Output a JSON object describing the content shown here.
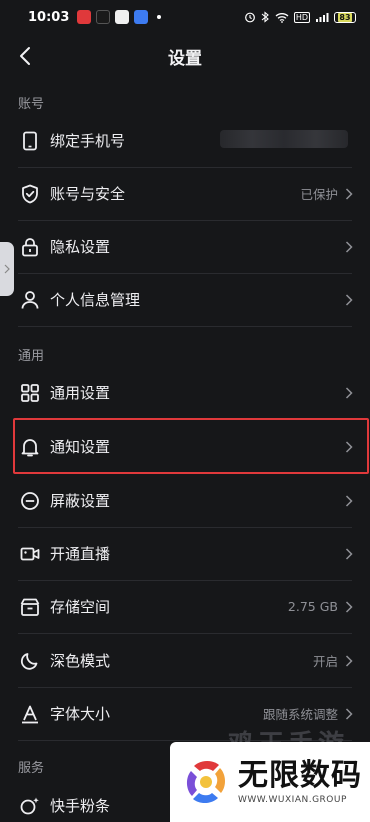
{
  "status_bar": {
    "time": "10:03",
    "battery": "83",
    "network": "HD",
    "app_icon_colors": [
      "#e0393b",
      "#1a1a1a",
      "#f0f0f0",
      "#3d7bf0"
    ]
  },
  "nav": {
    "title": "设置"
  },
  "sections": [
    {
      "header": "账号"
    },
    {
      "header": "通用"
    },
    {
      "header": "服务"
    }
  ],
  "rows": {
    "bind_phone": {
      "label": "绑定手机号",
      "value": "",
      "icon": "phone-icon"
    },
    "account_security": {
      "label": "账号与安全",
      "value": "已保护",
      "icon": "shield-check-icon"
    },
    "privacy": {
      "label": "隐私设置",
      "value": "",
      "icon": "lock-icon"
    },
    "personal_info": {
      "label": "个人信息管理",
      "value": "",
      "icon": "person-icon"
    },
    "general": {
      "label": "通用设置",
      "value": "",
      "icon": "grid-icon"
    },
    "notification": {
      "label": "通知设置",
      "value": "",
      "icon": "bell-icon"
    },
    "block": {
      "label": "屏蔽设置",
      "value": "",
      "icon": "minus-circle-icon"
    },
    "live": {
      "label": "开通直播",
      "value": "",
      "icon": "video-camera-icon"
    },
    "storage": {
      "label": "存储空间",
      "value": "2.75 GB",
      "icon": "storage-box-icon"
    },
    "dark_mode": {
      "label": "深色模式",
      "value": "开启",
      "icon": "moon-icon"
    },
    "font_size": {
      "label": "字体大小",
      "value": "跟随系统调整",
      "icon": "font-a-icon"
    },
    "fans": {
      "label": "快手粉条",
      "value": "",
      "icon": "fans-sparkle-icon"
    }
  },
  "watermark": {
    "ghost_text": "鸡王手游",
    "title": "无限数码",
    "subtitle": "WWW.WUXIAN.GROUP"
  },
  "colors": {
    "background": "#161719",
    "highlight": "#e0393b",
    "secondary_text": "#8f9096"
  }
}
